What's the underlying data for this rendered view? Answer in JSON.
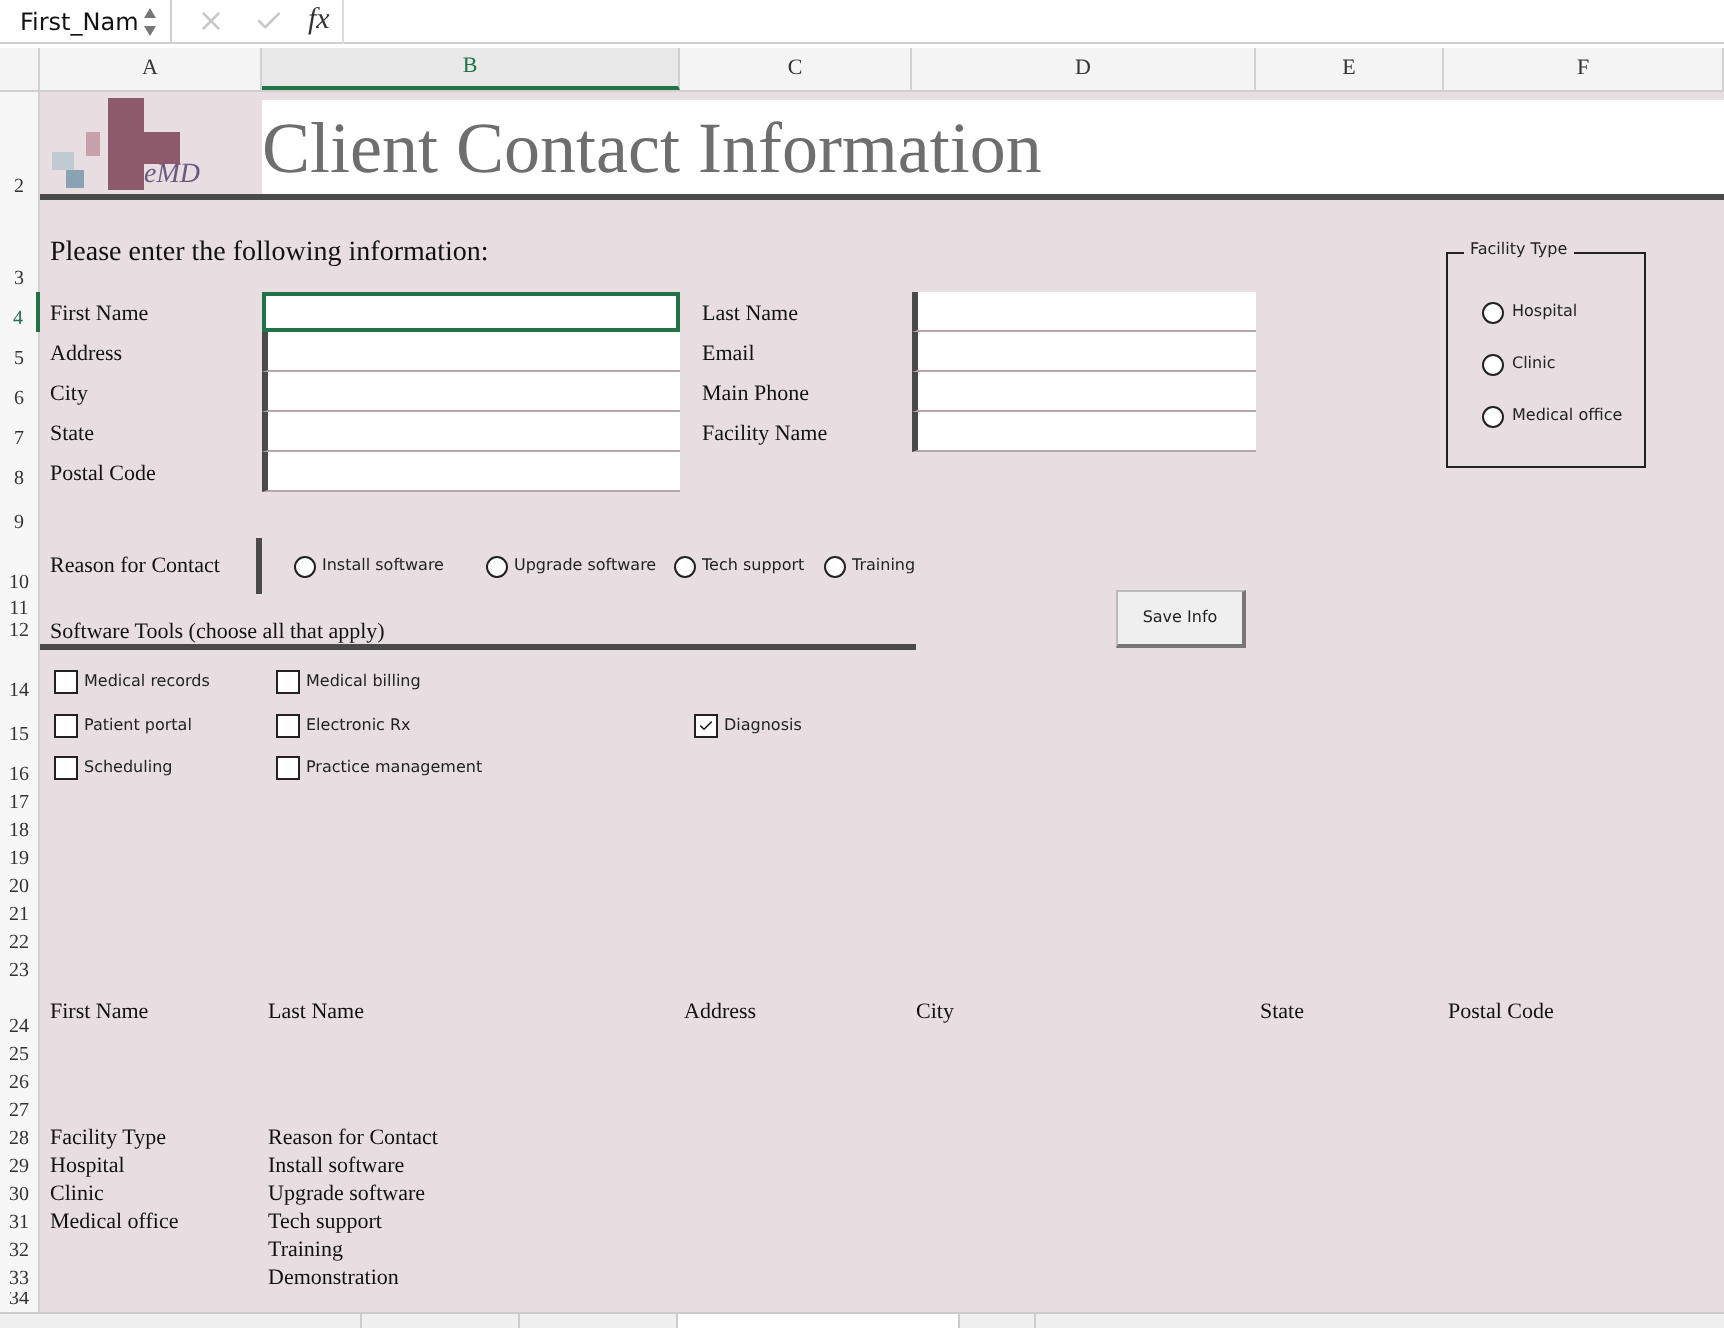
{
  "name_box": "First_Nam",
  "function_label": "fx",
  "columns": [
    {
      "label": "A",
      "selected": false
    },
    {
      "label": "B",
      "selected": true
    },
    {
      "label": "C",
      "selected": false
    },
    {
      "label": "D",
      "selected": false
    },
    {
      "label": "E",
      "selected": false
    },
    {
      "label": "F",
      "selected": false
    }
  ],
  "rows": [
    {
      "selected": false
    },
    {
      "number": "2",
      "selected": false
    },
    {
      "number": "3",
      "selected": false
    },
    {
      "number": "4",
      "selected": true
    },
    {
      "number": "5",
      "selected": false
    },
    {
      "number": "6",
      "selected": false
    },
    {
      "number": "7",
      "selected": false
    },
    {
      "number": "8",
      "selected": false
    },
    {
      "number": "9",
      "selected": false
    },
    {
      "number": "10",
      "selected": false
    },
    {
      "number": "11",
      "selected": false
    },
    {
      "number": "12",
      "selected": false
    },
    {
      "selected": false
    },
    {
      "number": "14",
      "selected": false
    },
    {
      "number": "15",
      "selected": false
    },
    {
      "number": "16",
      "selected": false
    },
    {
      "number": "17",
      "selected": false
    },
    {
      "number": "18",
      "selected": false
    },
    {
      "number": "19",
      "selected": false
    },
    {
      "number": "20",
      "selected": false
    },
    {
      "number": "21",
      "selected": false
    },
    {
      "number": "22",
      "selected": false
    },
    {
      "number": "23",
      "selected": false
    },
    {
      "number": "24",
      "selected": false
    },
    {
      "number": "25",
      "selected": false
    },
    {
      "number": "26",
      "selected": false
    },
    {
      "number": "27",
      "selected": false
    },
    {
      "number": "28",
      "selected": false
    },
    {
      "number": "29",
      "selected": false
    },
    {
      "number": "30",
      "selected": false
    },
    {
      "number": "31",
      "selected": false
    },
    {
      "number": "32",
      "selected": false
    },
    {
      "number": "33",
      "selected": false
    },
    {
      "number": "34",
      "selected": false
    }
  ],
  "logo_text": "eMD",
  "title": "Client Contact Information",
  "instructions": "Please enter the following information:",
  "fields_left": [
    {
      "label": "First Name",
      "selected": true
    },
    {
      "label": "Address",
      "selected": false
    },
    {
      "label": "City",
      "selected": false
    },
    {
      "label": "State",
      "selected": false
    },
    {
      "label": "Postal Code",
      "selected": false
    }
  ],
  "fields_right": [
    {
      "label": "Last Name"
    },
    {
      "label": "Email"
    },
    {
      "label": "Main Phone"
    },
    {
      "label": "Facility Name"
    }
  ],
  "facility_type": {
    "title": "Facility Type",
    "options": [
      {
        "label": "Hospital",
        "selected": false
      },
      {
        "label": "Clinic",
        "selected": false
      },
      {
        "label": "Medical office",
        "selected": false
      }
    ]
  },
  "reason_for_contact": {
    "label": "Reason for Contact",
    "options": [
      {
        "label": "Install software",
        "selected": false
      },
      {
        "label": "Upgrade software",
        "selected": false
      },
      {
        "label": "Tech support",
        "selected": false
      },
      {
        "label": "Training",
        "selected": false
      }
    ]
  },
  "save_button": "Save Info",
  "software_tools": {
    "label": "Software Tools (choose all that apply)",
    "options": [
      {
        "label": "Medical records",
        "checked": false
      },
      {
        "label": "Medical billing",
        "checked": false
      },
      {
        "label": "Patient portal",
        "checked": false
      },
      {
        "label": "Electronic Rx",
        "checked": false
      },
      {
        "label": "Diagnosis",
        "checked": true
      },
      {
        "label": "Scheduling",
        "checked": false
      },
      {
        "label": "Practice management",
        "checked": false
      }
    ]
  },
  "table_headers": [
    "First Name",
    "Last Name",
    "Address",
    "City",
    "State",
    "Postal Code"
  ],
  "lists": [
    {
      "header": "Facility Type",
      "items": [
        "Hospital",
        "Clinic",
        "Medical office"
      ]
    },
    {
      "header": "Reason for Contact",
      "items": [
        "Install software",
        "Upgrade software",
        "Tech support",
        "Training",
        "Demonstration"
      ]
    }
  ],
  "sheet_tabs": [
    {
      "selected": false
    },
    {
      "selected": false
    },
    {
      "selected": false
    },
    {
      "selected": true
    },
    {
      "selected": false
    }
  ]
}
